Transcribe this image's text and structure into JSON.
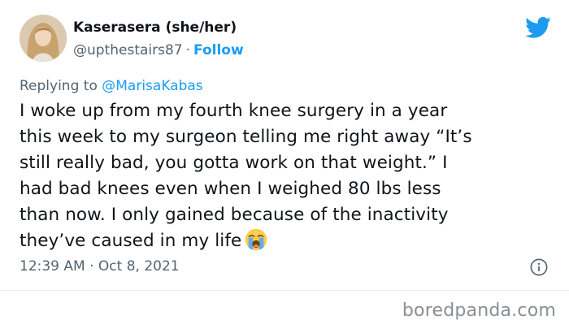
{
  "tweet": {
    "author": {
      "display_name": "Kaserasera (she/her)",
      "handle": "@upthestairs87",
      "separator": "·",
      "follow_label": "Follow"
    },
    "reply": {
      "prefix": "Replying to",
      "mention": "@MarisaKabas"
    },
    "text_lines": [
      "I woke up from my fourth knee surgery in a year",
      "this week to my surgeon telling me right away “It’s",
      "still really bad, you gotta work on that weight.” I",
      "had bad knees even when I weighed 80 lbs less",
      "than now. I only gained because of the inactivity",
      "they’ve caused in my life"
    ],
    "emoji": "loudly-crying-face",
    "timestamp": "12:39 AM · Oct 8, 2021"
  },
  "icons": {
    "logo": "twitter-bird-icon",
    "info": "info-icon"
  },
  "colors": {
    "accent": "#1d9bf0",
    "text": "#0f1419",
    "secondary": "#536471",
    "watermark": "#8a8f94"
  },
  "watermark": "boredpanda.com"
}
